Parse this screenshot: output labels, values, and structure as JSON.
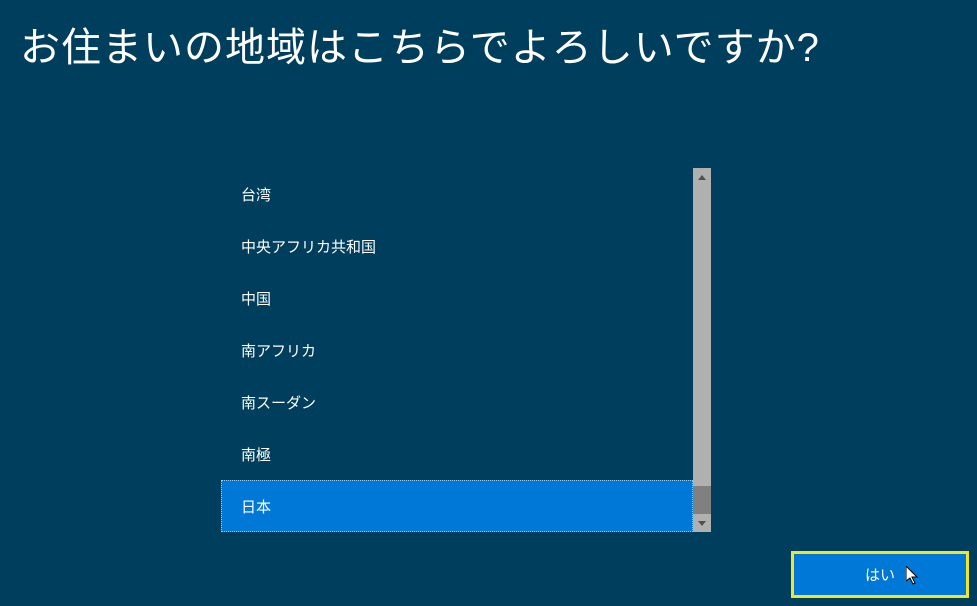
{
  "heading": "お住まいの地域はこちらでよろしいですか?",
  "regions": {
    "items": [
      {
        "label": "台湾",
        "selected": false
      },
      {
        "label": "中央アフリカ共和国",
        "selected": false
      },
      {
        "label": "中国",
        "selected": false
      },
      {
        "label": "南アフリカ",
        "selected": false
      },
      {
        "label": "南スーダン",
        "selected": false
      },
      {
        "label": "南極",
        "selected": false
      },
      {
        "label": "日本",
        "selected": true
      }
    ]
  },
  "confirm_button": {
    "label": "はい"
  }
}
